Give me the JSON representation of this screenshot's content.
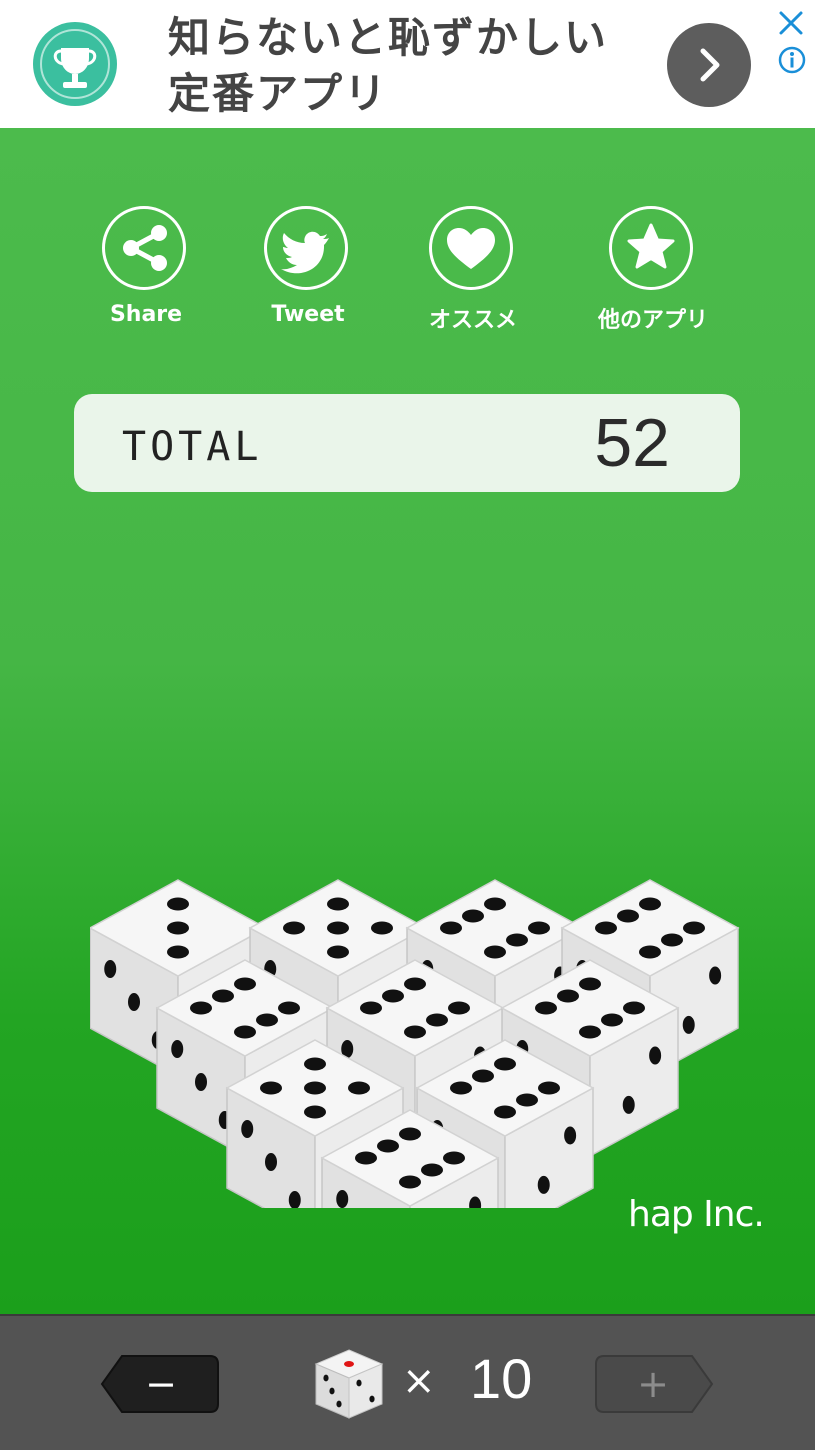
{
  "ad": {
    "line1": "知らないと恥ずかしい",
    "line2": "定番アプリ",
    "icon": "trophy-icon",
    "accent": "#3bbf9f"
  },
  "social": {
    "share": "Share",
    "tweet": "Tweet",
    "recommend": "オススメ",
    "other_apps": "他のアプリ"
  },
  "total": {
    "label": "TOTAL",
    "value": "52"
  },
  "credit": "hap Inc.",
  "controls": {
    "minus": "−",
    "plus": "+",
    "times": "×",
    "dice_count": "10"
  },
  "dice_faces_top": [
    3,
    5,
    6,
    6,
    6,
    6,
    6,
    5,
    6,
    6
  ],
  "colors": {
    "background_green": "#1ea21e",
    "panel": "#eaf5ea",
    "bottom_bar": "#535353"
  }
}
